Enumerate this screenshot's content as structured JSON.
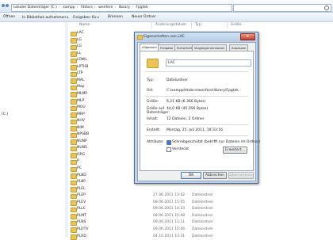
{
  "address_bar": {
    "path": [
      "Lokaler Datenträger (C:)",
      "xampp",
      "htdocs",
      "wenfore",
      "library",
      "Fpgtek"
    ]
  },
  "toolbar": {
    "items": [
      {
        "label": "Öffnen"
      },
      {
        "label": "In Bibliothek aufnehmen",
        "has_caret": true
      },
      {
        "label": "Freigeben für",
        "has_caret": true
      },
      {
        "label": "Brennen"
      },
      {
        "label": "Neuer Ordner"
      }
    ]
  },
  "left_pane": {
    "drive_label": "(C:)"
  },
  "file_list": {
    "columns": [
      "Name",
      "Änderungsdatum",
      "Typ",
      "Größe"
    ],
    "rows": [
      {
        "name": "LAC",
        "date": "",
        "type": ""
      },
      {
        "name": "LG",
        "date": "",
        "type": ""
      },
      {
        "name": "LG",
        "date": "",
        "type": ""
      },
      {
        "name": "LL",
        "date": "",
        "type": ""
      },
      {
        "name": "LOWL",
        "date": "",
        "type": ""
      },
      {
        "name": "LPTHB",
        "date": "",
        "type": ""
      },
      {
        "name": "LTP",
        "date": "",
        "type": ""
      },
      {
        "name": "MAL",
        "date": "",
        "type": ""
      },
      {
        "name": "Map",
        "date": "",
        "type": ""
      },
      {
        "name": "MLMP",
        "date": "",
        "type": ""
      },
      {
        "name": "MLP",
        "date": "",
        "type": ""
      },
      {
        "name": "MOU",
        "date": "",
        "type": ""
      },
      {
        "name": "MRP",
        "date": "",
        "type": ""
      },
      {
        "name": "NHV",
        "date": "",
        "type": ""
      },
      {
        "name": "NIM",
        "date": "",
        "type": ""
      },
      {
        "name": "NPSBB",
        "date": "",
        "type": ""
      },
      {
        "name": "NUNP",
        "date": "",
        "type": ""
      },
      {
        "name": "NUNS",
        "date": "",
        "type": ""
      },
      {
        "name": "ORG",
        "date": "",
        "type": ""
      },
      {
        "name": "P",
        "date": "",
        "type": ""
      },
      {
        "name": "PC",
        "date": "",
        "type": ""
      },
      {
        "name": "PLBD",
        "date": "",
        "type": ""
      },
      {
        "name": "PLBP",
        "date": "",
        "type": ""
      },
      {
        "name": "PLEL",
        "date": "",
        "type": ""
      },
      {
        "name": "PLEP",
        "date": "27.06.2011 13:42",
        "type": "Dateiordner"
      },
      {
        "name": "PLEV",
        "date": "08.06.2011 15:05",
        "type": "Dateiordner"
      },
      {
        "name": "PLLC",
        "date": "09.06.2011 14:23",
        "type": "Dateiordner"
      },
      {
        "name": "PLMT",
        "date": "08.06.2011 15:48",
        "type": "Dateiordner"
      },
      {
        "name": "PLNS",
        "date": "09.06.2011 11:11",
        "type": "Dateiordner"
      },
      {
        "name": "PLOTV",
        "date": "09.06.2011 15:06",
        "type": "Dateiordner"
      },
      {
        "name": "PLRD",
        "date": "04.10.2011 13:31",
        "type": "Dateiordner"
      }
    ]
  },
  "dialog": {
    "title": "Eigenschaften von LAC",
    "close_glyph": "x",
    "tabs": [
      "Allgemein",
      "Freigabe",
      "Sicherheit",
      "Vorgängerversionen",
      "Anpassen"
    ],
    "active_tab": 0,
    "name_value": "LAC",
    "properties": {
      "typ_label": "Typ:",
      "typ_value": "Dateiordner",
      "ort_label": "Ort:",
      "ort_value": "C:\\xampp\\htdocs\\wenfore\\library\\Fpgtek",
      "groesse_label": "Größe:",
      "groesse_value": "6,21 KB (6.366 Bytes)",
      "datentraeger_label": "Größe auf Datenträger:",
      "datentraeger_value": "44,0 KB (45.056 Bytes)",
      "inhalt_label": "Inhalt:",
      "inhalt_value": "12 Dateien, 2 Ordner",
      "erstellt_label": "Erstellt:",
      "erstellt_value": "Montag, 25. Juli 2011, 19:33:16",
      "attribute_label": "Attribute:"
    },
    "attributes": {
      "readonly_label": "Schreibgeschützt (betrifft nur Dateien im Ordner)",
      "readonly_checked": true,
      "hidden_label": "Versteckt",
      "hidden_checked": false,
      "advanced_button": "Erweitert..."
    },
    "buttons": {
      "ok": "OK",
      "cancel": "Abbrechen",
      "apply": "Übernehmen"
    }
  }
}
